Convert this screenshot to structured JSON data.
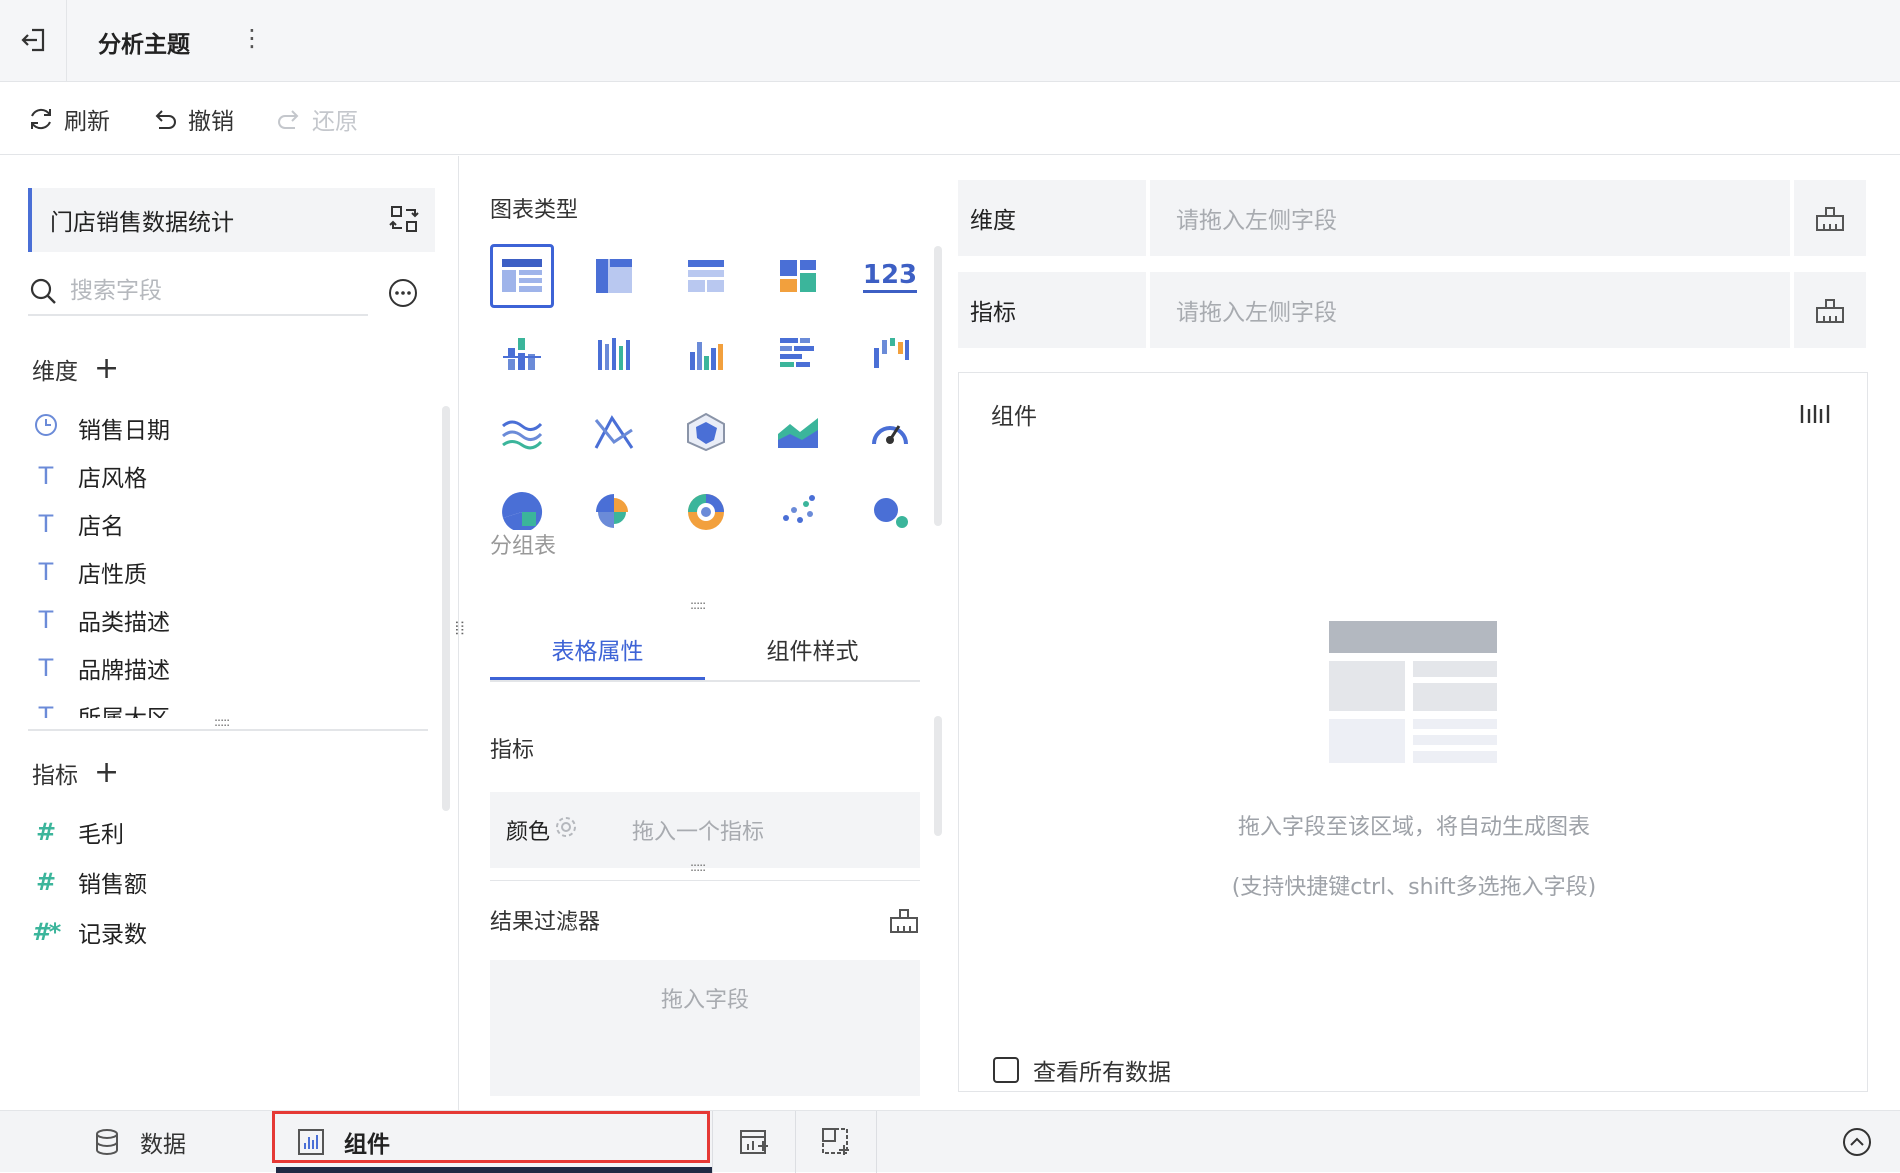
{
  "header": {
    "title": "分析主题",
    "more": "⋮"
  },
  "toolbar": {
    "refresh": "刷新",
    "undo": "撤销",
    "redo": "还原"
  },
  "left": {
    "dataset": "门店销售数据统计",
    "search_placeholder": "搜索字段",
    "dimensions_title": "维度",
    "dimensions": [
      {
        "icon": "clock-icon",
        "label": "销售日期"
      },
      {
        "icon": "text-type-icon",
        "label": "店风格"
      },
      {
        "icon": "text-type-icon",
        "label": "店名"
      },
      {
        "icon": "text-type-icon",
        "label": "店性质"
      },
      {
        "icon": "text-type-icon",
        "label": "品类描述"
      },
      {
        "icon": "text-type-icon",
        "label": "品牌描述"
      },
      {
        "icon": "text-type-icon",
        "label": "所属大区"
      }
    ],
    "measures_title": "指标",
    "measures": [
      {
        "icon": "hash-icon",
        "label": "毛利"
      },
      {
        "icon": "hash-icon",
        "label": "销售额"
      },
      {
        "icon": "hash-star-icon",
        "label": "记录数"
      }
    ]
  },
  "middle": {
    "chart_types_title": "图表类型",
    "selected_chart_label": "分组表",
    "kpi_label": "123",
    "tabs": [
      {
        "label": "表格属性",
        "active": true
      },
      {
        "label": "组件样式",
        "active": false
      }
    ],
    "measure_section": "指标",
    "color_label": "颜色",
    "color_placeholder": "拖入一个指标",
    "filter_section": "结果过滤器",
    "filter_placeholder": "拖入字段"
  },
  "right": {
    "dimension_label": "维度",
    "dimension_placeholder": "请拖入左侧字段",
    "measure_label": "指标",
    "measure_placeholder": "请拖入左侧字段",
    "canvas_title": "组件",
    "hint_main": "拖入字段至该区域，将自动生成图表",
    "hint_sub": "(支持快捷键ctrl、shift多选拖入字段)",
    "show_all_data": "查看所有数据"
  },
  "bottom": {
    "tabs": [
      {
        "label": "数据",
        "active": false
      },
      {
        "label": "组件",
        "active": true
      }
    ]
  },
  "colors": {
    "accent": "#3d63d6",
    "highlight": "#e53935",
    "measure": "#3bb59b"
  }
}
